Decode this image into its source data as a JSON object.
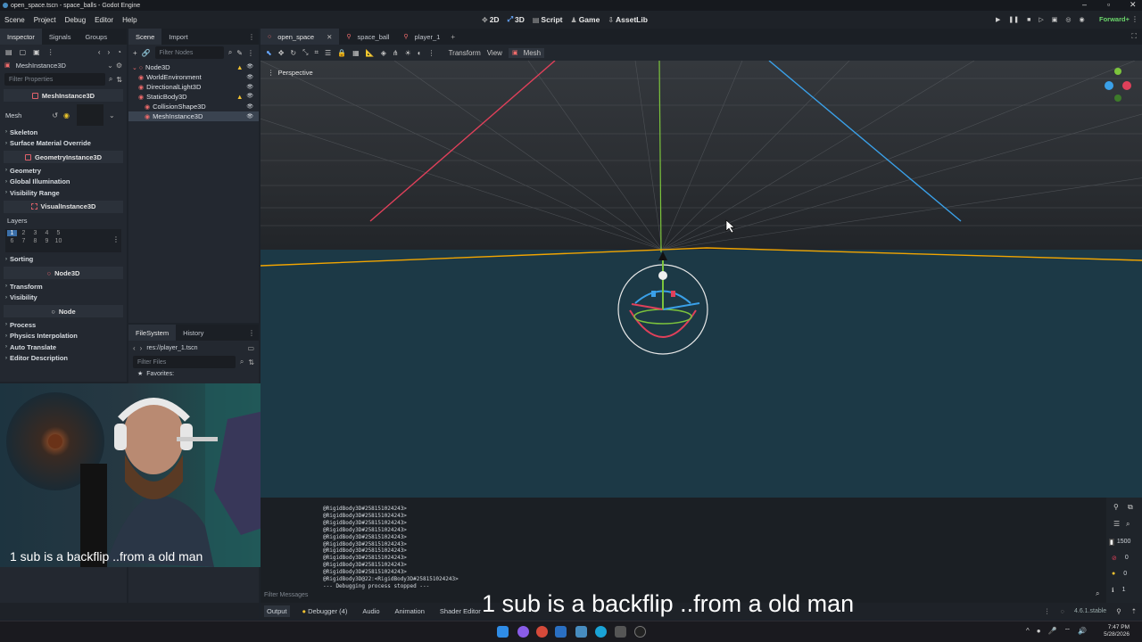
{
  "window": {
    "title": "open_space.tscn - space_balls - Godot Engine"
  },
  "menu": [
    "Scene",
    "Project",
    "Debug",
    "Editor",
    "Help"
  ],
  "workspaces": [
    {
      "label": "2D",
      "glyph": "✥"
    },
    {
      "label": "3D",
      "glyph": "⤢",
      "active": true
    },
    {
      "label": "Script",
      "glyph": "▤"
    },
    {
      "label": "Game",
      "glyph": "♟"
    },
    {
      "label": "AssetLib",
      "glyph": "⇩"
    }
  ],
  "renderer": "Forward+",
  "inspector": {
    "tabs": [
      "Inspector",
      "Signals",
      "Groups"
    ],
    "object": "MeshInstance3D",
    "filter_placeholder": "Filter Properties",
    "class_header": "MeshInstance3D",
    "mesh_label": "Mesh",
    "sections_a": [
      "Skeleton",
      "Surface Material Override"
    ],
    "geometry_header": "GeometryInstance3D",
    "sections_b": [
      "Geometry",
      "Global Illumination",
      "Visibility Range"
    ],
    "visual_header": "VisualInstance3D",
    "layers_label": "Layers",
    "layers_row1": [
      "1",
      "2",
      "3",
      "4",
      "5"
    ],
    "layers_row2": [
      "6",
      "7",
      "8",
      "9",
      "10"
    ],
    "sorting_label": "Sorting",
    "node3d_header": "Node3D",
    "sections_c": [
      "Transform",
      "Visibility"
    ],
    "node_header": "Node",
    "sections_d": [
      "Process",
      "Physics Interpolation",
      "Auto Translate",
      "Editor Description"
    ]
  },
  "scene": {
    "tabs": [
      "Scene",
      "Import"
    ],
    "filter_placeholder": "Filter Nodes",
    "nodes": [
      {
        "name": "Node3D",
        "depth": 0,
        "warn": true
      },
      {
        "name": "WorldEnvironment",
        "depth": 1
      },
      {
        "name": "DirectionalLight3D",
        "depth": 1
      },
      {
        "name": "StaticBody3D",
        "depth": 1,
        "warn": true
      },
      {
        "name": "CollisionShape3D",
        "depth": 2
      },
      {
        "name": "MeshInstance3D",
        "depth": 2,
        "selected": true
      }
    ]
  },
  "filesystem": {
    "tabs": [
      "FileSystem",
      "History"
    ],
    "path": "res://player_1.tscn",
    "filter_placeholder": "Filter Files",
    "favorites": "Favorites:",
    "root": "res://"
  },
  "editor_tabs": [
    {
      "label": "open_space",
      "active": true
    },
    {
      "label": "space_ball"
    },
    {
      "label": "player_1"
    }
  ],
  "viewport": {
    "toolbar_menus": [
      "Transform",
      "View"
    ],
    "mesh_menu": "Mesh",
    "perspective_label": "Perspective"
  },
  "console": {
    "lines": [
      "@RigidBody3D#258151024243>",
      "@RigidBody3D#258151024243>",
      "@RigidBody3D#258151024243>",
      "@RigidBody3D#258151024243>",
      "@RigidBody3D#258151024243>",
      "@RigidBody3D#258151024243>",
      "@RigidBody3D#258151024243>",
      "@RigidBody3D#258151024243>",
      "@RigidBody3D#258151024243>",
      "@RigidBody3D#258151024243>",
      "@RigidBody3D@22:<RigidBody3D#258151024243>",
      "--- Debugging process stopped ---"
    ],
    "filter_placeholder": "Filter Messages",
    "counts": {
      "messages": "1500",
      "errors": "0",
      "warnings": "0",
      "info": "1"
    }
  },
  "bottom_tabs": [
    {
      "label": "Output",
      "active": true
    },
    {
      "label": "Debugger (4)"
    },
    {
      "label": "Audio"
    },
    {
      "label": "Animation"
    },
    {
      "label": "Shader Editor"
    }
  ],
  "version": "4.6.1.stable",
  "overlay": {
    "caption_small": "1 sub is a backflip ..from a old man",
    "caption_large": "1 sub is a backflip ..from a old man"
  },
  "taskbar": {
    "time": "7:47 PM",
    "date": "5/28/2026"
  },
  "colors": {
    "accent": "#478cbf",
    "x_axis": "#e0405a",
    "y_axis": "#7cc43c",
    "z_axis": "#3aa0e8",
    "selection_outline": "#f2a500"
  }
}
